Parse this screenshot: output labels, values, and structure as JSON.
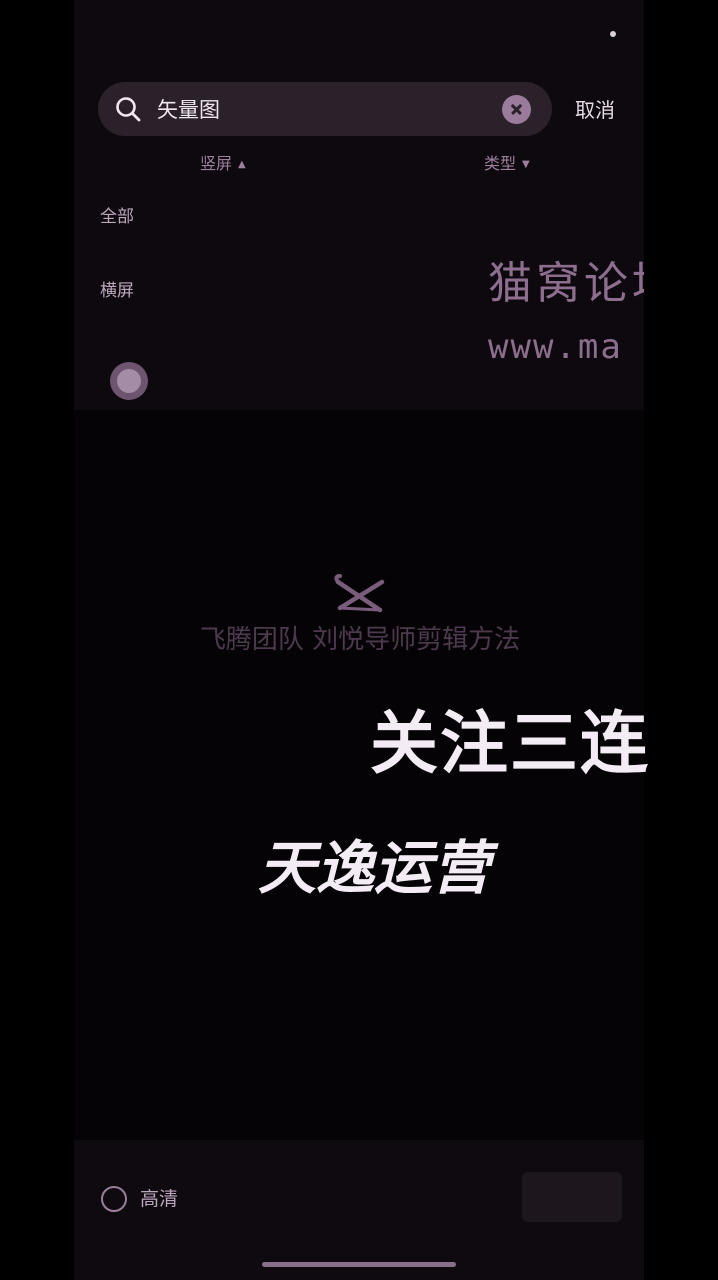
{
  "search": {
    "query": "矢量图",
    "cancel_label": "取消"
  },
  "filters": {
    "orientation_label": "竖屏",
    "type_label": "类型",
    "caret": "▲",
    "type_caret": "▼"
  },
  "sidebar": {
    "items": [
      {
        "label": "全部"
      },
      {
        "label": "横屏"
      }
    ]
  },
  "watermark": {
    "chinese": "猫窝论坛",
    "url": "www.ma"
  },
  "overlay": {
    "team_text": "飞腾团队 刘悦导师剪辑方法",
    "follow_text": "关注三连",
    "operator_text": "天逸运营"
  },
  "bottom": {
    "hd_label": "高清"
  },
  "colors": {
    "background": "#000000",
    "accent": "#9a7b9c",
    "text": "#efe6ef"
  }
}
